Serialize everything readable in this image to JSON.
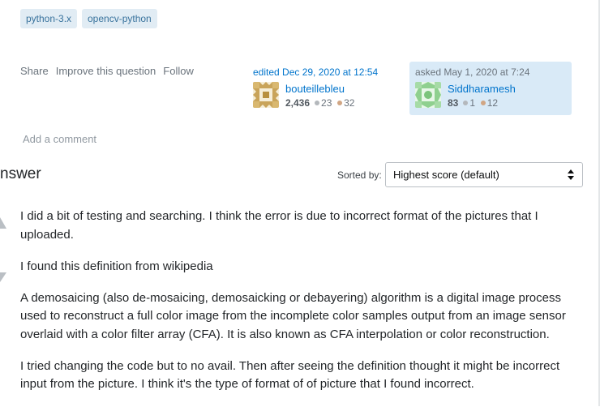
{
  "tags": [
    "python-3.x",
    "opencv-python"
  ],
  "post_menu": {
    "share": "Share",
    "improve": "Improve this question",
    "follow": "Follow"
  },
  "editor": {
    "time": "edited Dec 29, 2020 at 12:54",
    "name": "bouteillebleu",
    "rep": "2,436",
    "silver": "23",
    "bronze": "32"
  },
  "asker": {
    "time": "asked May 1, 2020 at 7:24",
    "name": "Siddharamesh",
    "rep": "83",
    "silver": "1",
    "bronze": "12",
    "bg": "#d9eaf7"
  },
  "add_comment": "Add a comment",
  "answers": {
    "title": "nswer",
    "sorted_label": "Sorted by:",
    "sort_selected": "Highest score (default)"
  },
  "answer_paragraphs": [
    "I did a bit of testing and searching. I think the error is due to incorrect format of the pictures that I uploaded.",
    "I found this definition from wikipedia",
    "A demosaicing (also de-mosaicing, demosaicking or debayering) algorithm is a digital image process used to reconstruct a full color image from the incomplete color samples output from an image sensor overlaid with a color filter array (CFA). It is also known as CFA interpolation or color reconstruction.",
    "I tried changing the code but to no avail. Then after seeing the definition thought it might be incorrect input from the picture. I think it's the type of format of of picture that I found incorrect."
  ],
  "colors": {
    "tag_bg": "#e1ecf4",
    "tag_text": "#39739d",
    "link": "#0074cc"
  }
}
